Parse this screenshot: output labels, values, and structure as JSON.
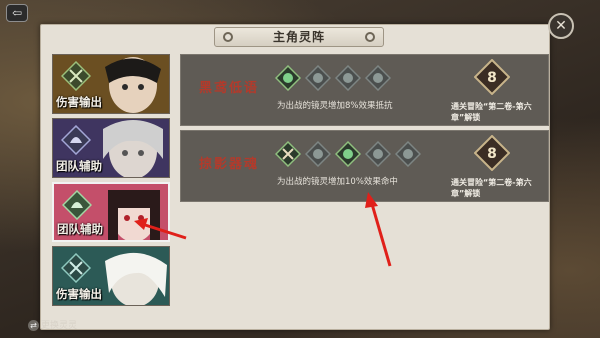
{
  "panel": {
    "title": "主角灵阵"
  },
  "characters": [
    {
      "role": "伤害输出",
      "selected": false,
      "tint": "#6b4f22",
      "emblem": "crossed-swords-icon"
    },
    {
      "role": "团队辅助",
      "selected": false,
      "tint": "#3f3560",
      "emblem": "helmet-icon"
    },
    {
      "role": "团队辅助",
      "selected": true,
      "tint": "#c44f6a",
      "emblem": "helmet-icon"
    },
    {
      "role": "伤害输出",
      "selected": false,
      "tint": "#2c5a56",
      "emblem": "crossed-swords-icon"
    }
  ],
  "change_button": {
    "label": "更换灵灵"
  },
  "formations": [
    {
      "name": "黑鸢低语",
      "desc": "为出战的镜灵增加8%效果抵抗",
      "slots": [
        "green-gem-icon",
        "gray-gem-icon",
        "gray-gem-icon",
        "gray-gem-icon"
      ],
      "unlock_level": "8",
      "unlock_text": "通关冒险“第二卷-第六章”解锁"
    },
    {
      "name": "掠影器魂",
      "desc": "为出战的镜灵增加10%效果命中",
      "slots": [
        "crossed-swords-icon",
        "gray-gem-icon",
        "green-gem-icon",
        "gray-gem-icon",
        "gray-gem-icon"
      ],
      "unlock_level": "8",
      "unlock_text": "通关冒险“第二卷-第六章”解锁"
    }
  ],
  "colors": {
    "accent_red": "#b33a2b",
    "arrow_red": "#e0201a",
    "panel_bg": "#e5e0d6",
    "row_bg": "#5f5b55"
  }
}
